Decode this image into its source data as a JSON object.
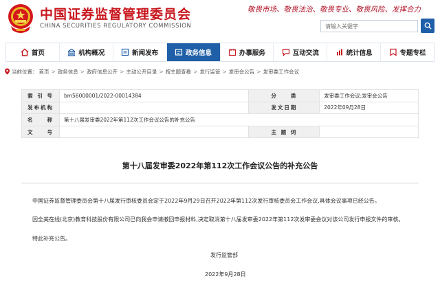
{
  "header": {
    "org_name_cn": "中国证券监督管理委员会",
    "org_name_en": "CHINA SECURITIES REGULATORY COMMISSION",
    "slogan": "敬畏市场、敬畏法治、敬畏专业、敬畏风险、发挥合力",
    "search": {
      "placeholder": "请输入关键字"
    },
    "icons": {
      "emblem": "national-emblem-icon",
      "search": "search-icon"
    }
  },
  "nav": {
    "items": [
      {
        "label": "首页",
        "icon": "home-icon"
      },
      {
        "label": "机构概况",
        "icon": "building-icon"
      },
      {
        "label": "新闻发布",
        "icon": "news-icon"
      },
      {
        "label": "政务信息",
        "icon": "info-icon",
        "active": true
      },
      {
        "label": "办事服务",
        "icon": "service-icon"
      },
      {
        "label": "互动交流",
        "icon": "chat-icon"
      },
      {
        "label": "统计信息",
        "icon": "chart-icon"
      },
      {
        "label": "专题专栏",
        "icon": "topic-icon"
      }
    ]
  },
  "breadcrumb": {
    "prefix": "当前位置：",
    "items": [
      "首页",
      "政务信息",
      "政府信息公开",
      "主动公开目录",
      "按主题查看",
      "发行监管",
      "发审会公告",
      "发审委工作会议"
    ]
  },
  "info_table": {
    "index_no_label": "索 引 号",
    "index_no": "bm56000001/2022-00014384",
    "category_label": "分　　类",
    "category": "发审委工作会议;发审会公告",
    "issuer_label": "发布机构",
    "issuer": "",
    "date_label": "发文日期",
    "date": "2022年09月28日",
    "name_label": "名　　称",
    "name": "第十八届发审委2022年第112次工作会议公告的补充公告",
    "doc_no_label": "文　　号",
    "doc_no": "",
    "subject_label": "主 题 词",
    "subject": ""
  },
  "article": {
    "title": "第十八届发审委2022年第112次工作会议公告的补充公告",
    "paragraphs": [
      "中国证券监督管理委员会第十八届发行审核委员会定于2022年9月29日召开2022年第112次发行审核委员会工作会议,具体会议事项已经公告。",
      "因全美在线(北京)教育科技股份有限公司已向我会申请撤回申报材料,决定取消第十八届发审委2022年第112次发审委会议对该公司发行申报文件的审核。",
      "特此补充公告。"
    ],
    "signature": "发行监管部",
    "sign_date": "2022年9月28日"
  }
}
